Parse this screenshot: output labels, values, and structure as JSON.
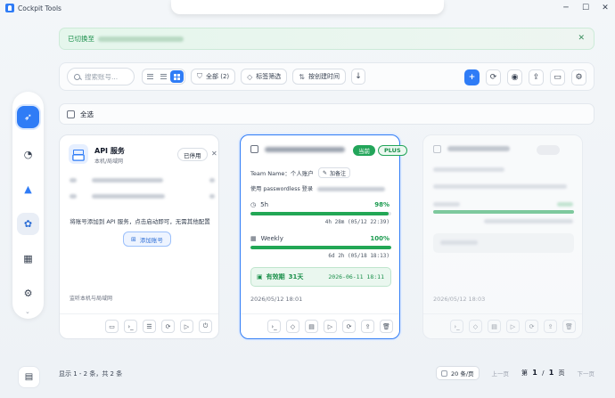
{
  "window": {
    "title": "Cockpit Tools",
    "minimize": "─",
    "maximize": "☐",
    "close": "✕"
  },
  "banner": {
    "text": "已切换至"
  },
  "toolbar": {
    "search_placeholder": "搜索账号...",
    "filter_all": "全部 (2)",
    "tag_filter": "标签筛选",
    "sort_label": "按创建时间"
  },
  "select_all": "全选",
  "api_card": {
    "title": "API 服务",
    "subtitle": "本机/局域网",
    "stop": "已停用",
    "hint": "将账号添加到 API 服务，点击启动即可，无需其他配置",
    "add_button": "添加账号",
    "bottom_text": "监听本机与局域网"
  },
  "account_card": {
    "tag_current": "当前",
    "tag_plan": "PLUS",
    "team_label": "Team Name：个人账户",
    "note_button": "加备注",
    "login_prefix": "使用 passwordless 登录",
    "quotas": [
      {
        "name": "5h",
        "percent": 98,
        "percent_text": "98%",
        "reset_text": "4h 28m (05/12 22:39)"
      },
      {
        "name": "Weekly",
        "percent": 100,
        "percent_text": "100%",
        "reset_text": "6d 2h (05/18 18:13)"
      }
    ],
    "valid_label": "有效期",
    "valid_days": "31天",
    "valid_date": "2026-06-11 18:11",
    "created": "2026/05/12 18:01"
  },
  "account_card_3": {
    "created": "2026/05/12 18:03"
  },
  "footer": {
    "info": "显示 1 - 2 条，共 2 条",
    "per_page": "20 条/页",
    "prev": "上一页",
    "page_prefix": "第",
    "page_current": "1",
    "page_mid": "/",
    "page_total": "1",
    "page_suffix": "页",
    "next": "下一页"
  },
  "colors": {
    "accent": "#2f7cf6",
    "success": "#23a55a"
  }
}
